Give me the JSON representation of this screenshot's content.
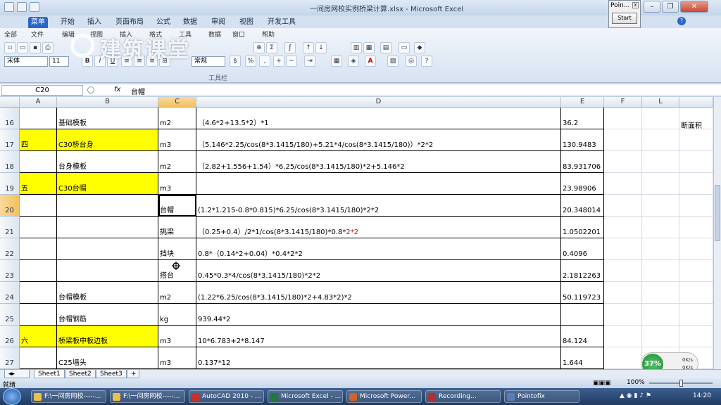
{
  "window": {
    "title": "一间房网校实例桥梁计算.xlsx - Microsoft Excel"
  },
  "ribbon_tabs": [
    "菜单",
    "开始",
    "插入",
    "页面布局",
    "公式",
    "数据",
    "审阅",
    "视图",
    "开发工具"
  ],
  "menu_items": [
    "全部",
    "文件",
    "编辑",
    "视图",
    "插入",
    "格式",
    "工具",
    "数据",
    "窗口",
    "帮助"
  ],
  "toolbar": {
    "font_name": "宋体",
    "font_size": "11",
    "number_format": "常规",
    "group_label": "工具栏"
  },
  "watermark": "建筑课堂",
  "pointofix": {
    "title": "Poin...",
    "start_label": "Start"
  },
  "formula_bar": {
    "name_box": "C20",
    "fx": "fx",
    "content": "台帽"
  },
  "columns": [
    "A",
    "B",
    "C",
    "D",
    "E",
    "F",
    "L"
  ],
  "rows": [
    {
      "num": "16",
      "a": "",
      "b": "基础模板",
      "c": "m2",
      "d": "（4.6*2+13.5*2）*1",
      "d_red": "",
      "e": "36.2",
      "yellow": false
    },
    {
      "num": "17",
      "a": "四",
      "b": "C30桥台身",
      "c": "m3",
      "d": "（5.146*2.25/cos(8*3.1415/180)+5.21*4/cos(8*3.1415/180)）*2*2",
      "d_red": "",
      "e": "130.9483",
      "yellow": true
    },
    {
      "num": "18",
      "a": "",
      "b": "台身模板",
      "c": "m2",
      "d": "（2.82+1.556+1.54）*6.25/cos(8*3.1415/180)*2+5.146*2",
      "d_red": "",
      "e": "83.931706",
      "yellow": false
    },
    {
      "num": "19",
      "a": "五",
      "b": "C30台帽",
      "c": "m3",
      "d": "",
      "d_red": "",
      "e": "23.98906",
      "yellow": true
    },
    {
      "num": "20",
      "a": "",
      "b": "",
      "c": "台帽",
      "d": "(1.2*1.215-0.8*0.815)*6.25/cos(8*3.1415/180)*2*2",
      "d_red": "",
      "e": "20.348014",
      "yellow": false
    },
    {
      "num": "21",
      "a": "",
      "b": "",
      "c": "挑梁",
      "d": "（0.25+0.4）/2*1/cos(8*3.1415/180)*0.8*",
      "d_red": "2*2",
      "e": "1.0502201",
      "yellow": false
    },
    {
      "num": "22",
      "a": "",
      "b": "",
      "c": "挡块",
      "d": "0.8*（0.14*2+0.04）*0.4*2*2",
      "d_red": "",
      "e": "0.4096",
      "yellow": false
    },
    {
      "num": "23",
      "a": "",
      "b": "",
      "c": "搭台",
      "d": "0.45*0.3*4/cos(8*3.1415/180)*2*2",
      "d_red": "",
      "e": "2.1812263",
      "yellow": false
    },
    {
      "num": "24",
      "a": "",
      "b": "台帽模板",
      "c": "m2",
      "d": "(1.22*6.25/cos(8*3.1415/180)*2+4.83*2)*2",
      "d_red": "",
      "e": "50.119723",
      "yellow": false
    },
    {
      "num": "25",
      "a": "",
      "b": "台帽钢筋",
      "c": "kg",
      "d": "939.44*2",
      "d_red": "",
      "e": "",
      "yellow": false
    },
    {
      "num": "26",
      "a": "六",
      "b": "桥梁板中板边板",
      "c": "m3",
      "d": "10*6.783+2*8.147",
      "d_red": "",
      "e": "84.124",
      "yellow": true
    },
    {
      "num": "27",
      "a": "",
      "b": "C25墙头",
      "c": "m3",
      "d": "0.137*12",
      "d_red": "",
      "e": "1.644",
      "yellow": false
    }
  ],
  "side_label": "断面积",
  "sheets": [
    "Sheet1",
    "Sheet2",
    "Sheet3"
  ],
  "status": {
    "ready": "就绪",
    "zoom": "100%"
  },
  "net": {
    "percent": "37%",
    "up": "0K/s",
    "down": "0K/s"
  },
  "taskbar": [
    {
      "label": "F:\\一间房网校-----...",
      "color": "#e8c04a"
    },
    {
      "label": "F:\\一间房网校-----...",
      "color": "#e8c04a"
    },
    {
      "label": "AutoCAD 2010 - ...",
      "color": "#c9302c"
    },
    {
      "label": "Microsoft Excel - ...",
      "color": "#1f7a3a"
    },
    {
      "label": "Microsoft Power...",
      "color": "#d2602a"
    },
    {
      "label": "Recording...",
      "color": "#b03030"
    },
    {
      "label": "Pointofix",
      "color": "#5a7db8"
    }
  ],
  "clock": "14:20"
}
